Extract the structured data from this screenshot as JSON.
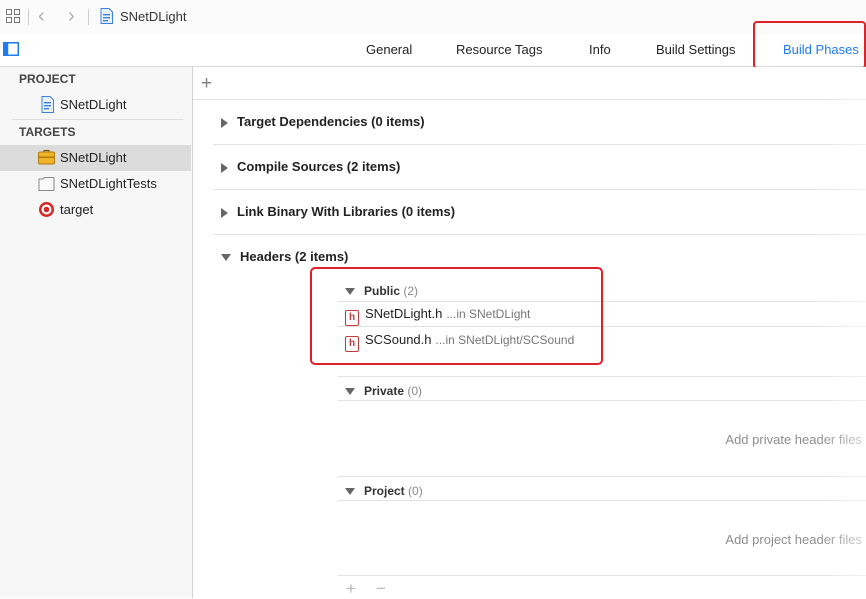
{
  "jumpbar": {
    "project_name": "SNetDLight"
  },
  "tabs": [
    {
      "label": "General"
    },
    {
      "label": "Resource Tags"
    },
    {
      "label": "Info"
    },
    {
      "label": "Build Settings"
    },
    {
      "label": "Build Phases",
      "active": true
    }
  ],
  "sidebar": {
    "project_header": "PROJECT",
    "project_item": "SNetDLight",
    "targets_header": "TARGETS",
    "targets": [
      {
        "label": "SNetDLight",
        "icon": "toolbox-icon",
        "selected": true
      },
      {
        "label": "SNetDLightTests",
        "icon": "test-bundle-icon"
      },
      {
        "label": "target",
        "icon": "target-icon"
      }
    ]
  },
  "main": {
    "add_symbol": "+",
    "phases": [
      {
        "label": "Target Dependencies (0 items)",
        "expanded": false
      },
      {
        "label": "Compile Sources (2 items)",
        "expanded": false
      },
      {
        "label": "Link Binary With Libraries (0 items)",
        "expanded": false
      },
      {
        "label": "Headers (2 items)",
        "expanded": true
      }
    ],
    "headers": {
      "public": {
        "label": "Public",
        "count": "(2)",
        "files": [
          {
            "name": "SNetDLight.h",
            "location": "...in SNetDLight"
          },
          {
            "name": "SCSound.h",
            "location": "...in SNetDLight/SCSound"
          }
        ]
      },
      "private": {
        "label": "Private",
        "count": "(0)",
        "hint": "Add private header files"
      },
      "project": {
        "label": "Project",
        "count": "(0)",
        "hint": "Add project header files"
      }
    },
    "plus": "+",
    "minus": "−",
    "file_icon_letter": "h"
  },
  "colors": {
    "accent": "#1e7bf0",
    "highlight": "#e0202a",
    "file_icon": "#c23b3b"
  }
}
